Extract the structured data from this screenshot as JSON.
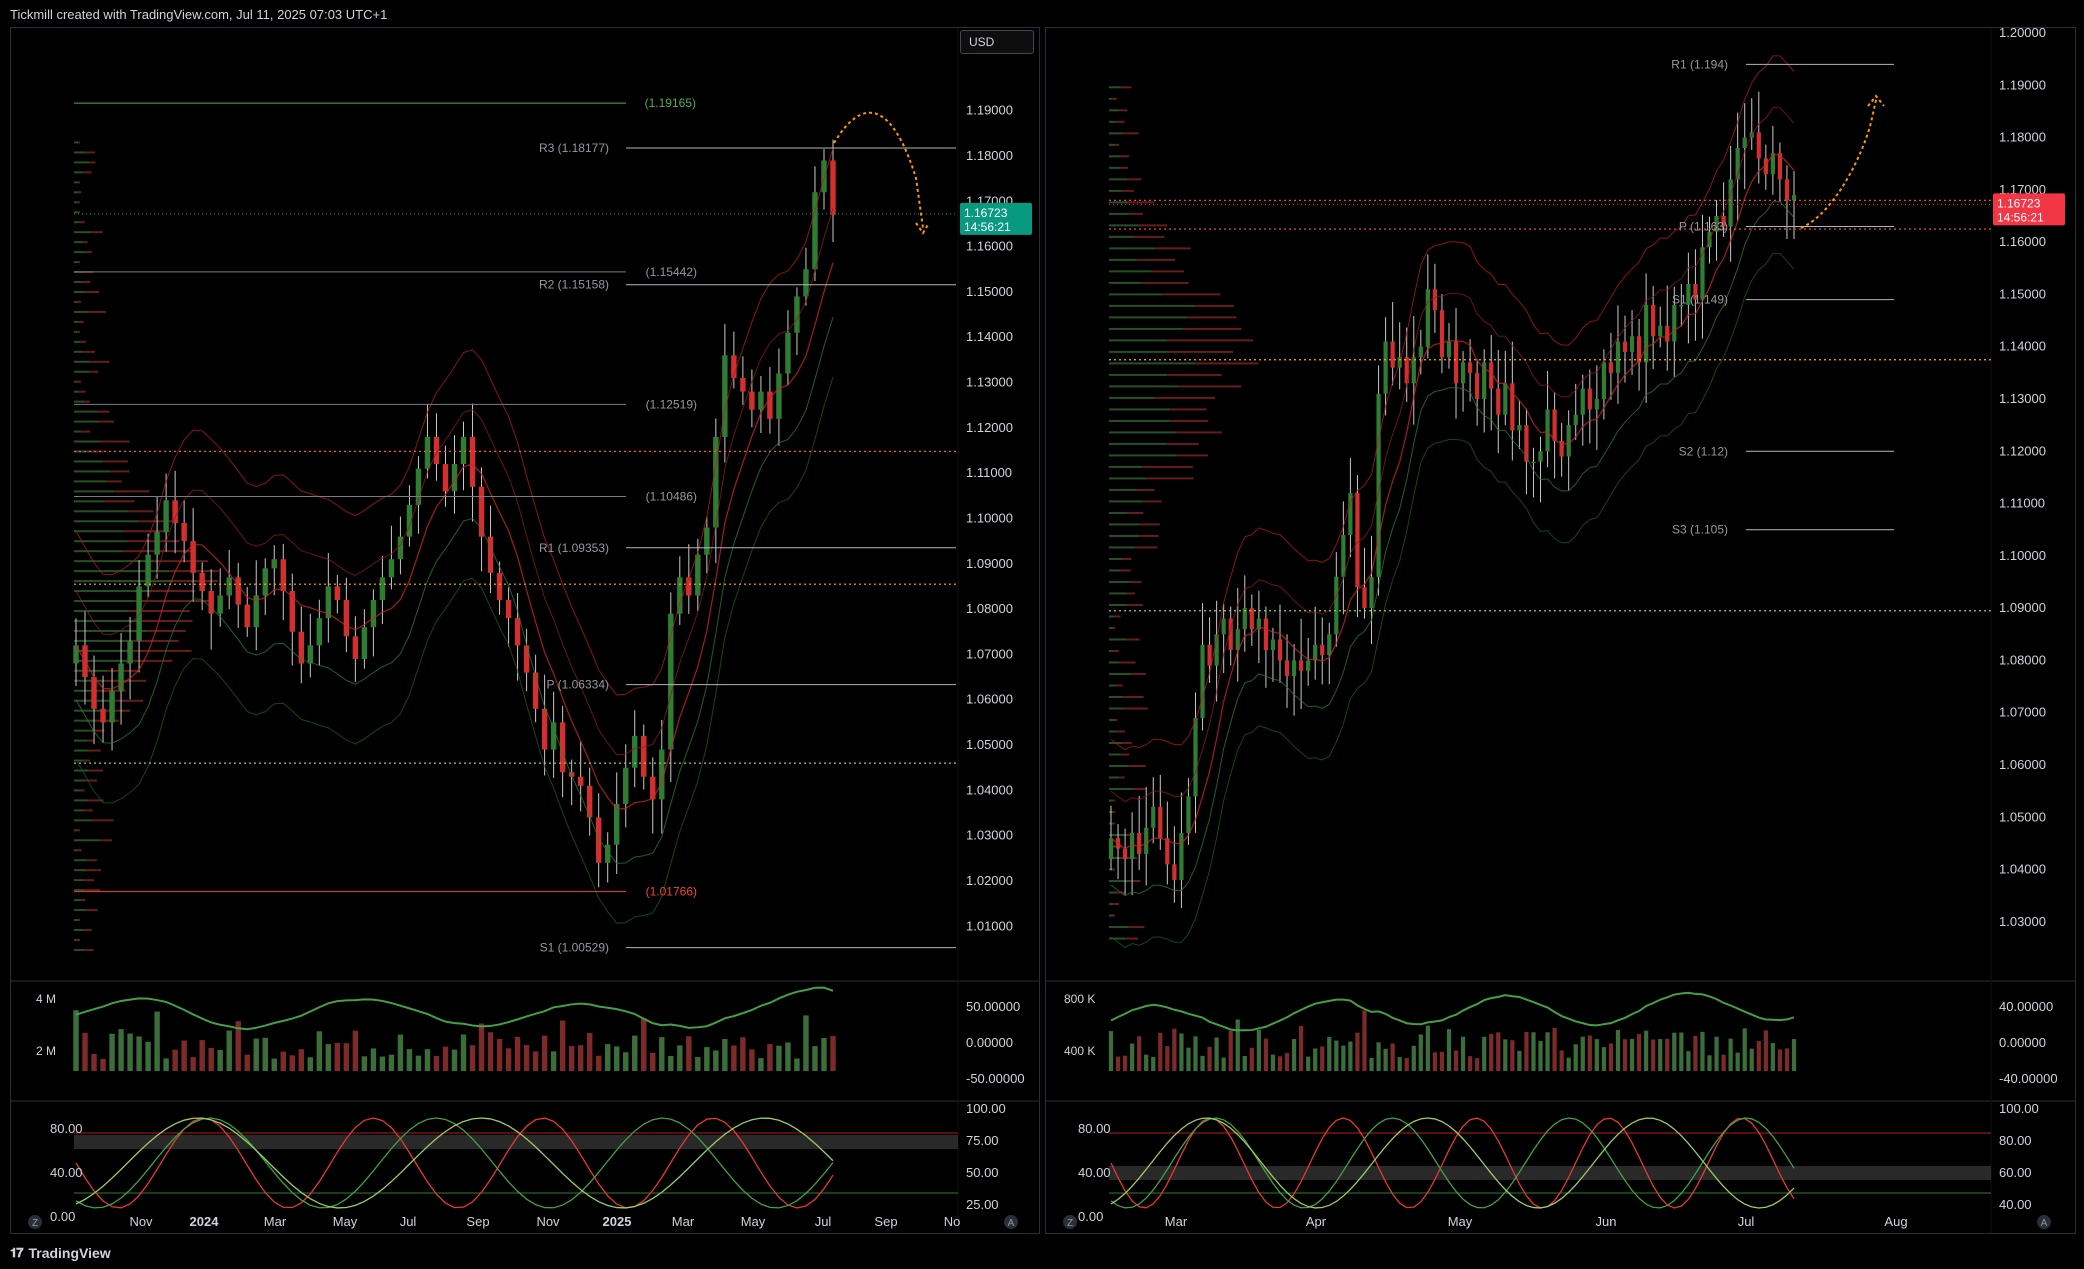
{
  "header": {
    "attribution": "Tickmill created with TradingView.com, Jul 11, 2025 07:03 UTC+1"
  },
  "footer": {
    "brand": "TradingView"
  },
  "currency_selector": {
    "label": "USD"
  },
  "colors": {
    "up": "#2e7d32",
    "down": "#d32f2f",
    "last_left": "#089981",
    "last_right": "#f23645",
    "pivot_line": "#ffffff",
    "orange": "#ff9800"
  },
  "left_chart": {
    "price_axis": [
      "1.19000",
      "1.18000",
      "1.17000",
      "1.16000",
      "1.15000",
      "1.14000",
      "1.13000",
      "1.12000",
      "1.11000",
      "1.10000",
      "1.09000",
      "1.08000",
      "1.07000",
      "1.06000",
      "1.05000",
      "1.04000",
      "1.03000",
      "1.02000",
      "1.01000"
    ],
    "last_price": "1.16723",
    "countdown": "14:56:21",
    "levels": [
      {
        "label": "(1.19165)",
        "color": "green"
      },
      {
        "label": "R3 (1.18177)",
        "color": "white"
      },
      {
        "label": "(1.15442)",
        "color": "gray"
      },
      {
        "label": "R2 (1.15158)",
        "color": "white"
      },
      {
        "label": "(1.12519)",
        "color": "gray"
      },
      {
        "label": "(1.10486)",
        "color": "gray"
      },
      {
        "label": "R1 (1.09353)",
        "color": "white"
      },
      {
        "label": "P (1.06334)",
        "color": "white"
      },
      {
        "label": "(1.01766)",
        "color": "red"
      },
      {
        "label": "S1 (1.00529)",
        "color": "white"
      }
    ],
    "volume_axis": [
      "4 M",
      "2 M"
    ],
    "osc_axis": [
      "50.00000",
      "0.00000",
      "-50.00000"
    ],
    "stoch_axis_left": [
      "80.00",
      "40.00",
      "0.00"
    ],
    "stoch_axis_right": [
      "100.00",
      "75.00",
      "50.00",
      "25.00"
    ],
    "time_axis": [
      "Nov",
      "2024",
      "Mar",
      "May",
      "Jul",
      "Sep",
      "Nov",
      "2025",
      "Mar",
      "May",
      "Jul",
      "Sep",
      "No"
    ],
    "corner_left": "Z",
    "corner_right": "A"
  },
  "right_chart": {
    "price_axis": [
      "1.20000",
      "1.19000",
      "1.18000",
      "1.17000",
      "1.16000",
      "1.15000",
      "1.14000",
      "1.13000",
      "1.12000",
      "1.11000",
      "1.10000",
      "1.09000",
      "1.08000",
      "1.07000",
      "1.06000",
      "1.05000",
      "1.04000",
      "1.03000"
    ],
    "last_price": "1.16723",
    "countdown": "14:56:21",
    "levels": [
      {
        "label": "R1 (1.194)"
      },
      {
        "label": "P (1.163)"
      },
      {
        "label": "S1 (1.149)"
      },
      {
        "label": "S2 (1.12)"
      },
      {
        "label": "S3 (1.105)"
      }
    ],
    "volume_axis": [
      "800 K",
      "400 K"
    ],
    "osc_axis": [
      "40.00000",
      "0.00000",
      "-40.00000"
    ],
    "stoch_axis_left": [
      "80.00",
      "40.00",
      "0.00"
    ],
    "stoch_axis_right": [
      "100.00",
      "80.00",
      "60.00",
      "40.00"
    ],
    "time_axis": [
      "Mar",
      "Apr",
      "May",
      "Jun",
      "Jul",
      "Aug"
    ],
    "corner_left": "Z",
    "corner_right": "A"
  },
  "chart_data": [
    {
      "type": "candlestick",
      "title": "",
      "timeframe": "weekly",
      "ylim": [
        1.003,
        1.195
      ],
      "x_range": [
        "2023-09",
        "2025-11"
      ],
      "closes_approx": [
        1.072,
        1.065,
        1.058,
        1.055,
        1.062,
        1.068,
        1.073,
        1.085,
        1.092,
        1.097,
        1.104,
        1.099,
        1.095,
        1.088,
        1.084,
        1.079,
        1.083,
        1.087,
        1.081,
        1.076,
        1.083,
        1.089,
        1.091,
        1.084,
        1.075,
        1.068,
        1.072,
        1.078,
        1.085,
        1.082,
        1.074,
        1.069,
        1.076,
        1.082,
        1.087,
        1.091,
        1.096,
        1.103,
        1.111,
        1.118,
        1.112,
        1.106,
        1.112,
        1.118,
        1.107,
        1.096,
        1.088,
        1.082,
        1.078,
        1.072,
        1.066,
        1.058,
        1.049,
        1.055,
        1.044,
        1.043,
        1.041,
        1.034,
        1.024,
        1.028,
        1.037,
        1.045,
        1.052,
        1.043,
        1.038,
        1.049,
        1.079,
        1.087,
        1.083,
        1.092,
        1.098,
        1.118,
        1.136,
        1.131,
        1.128,
        1.124,
        1.128,
        1.122,
        1.132,
        1.141,
        1.149,
        1.155,
        1.172,
        1.179,
        1.167
      ],
      "pivots": {
        "R3": 1.18177,
        "R2": 1.15158,
        "R1": 1.09353,
        "P": 1.06334,
        "S1": 1.00529
      },
      "annotations": [
        1.19165,
        1.15442,
        1.12519,
        1.10486,
        1.01766
      ],
      "last_price": 1.16723
    },
    {
      "type": "candlestick",
      "title": "",
      "timeframe": "daily",
      "ylim": [
        1.025,
        1.2
      ],
      "x_range": [
        "2025-02-20",
        "2025-08-15"
      ],
      "closes_approx": [
        1.046,
        1.044,
        1.042,
        1.047,
        1.043,
        1.048,
        1.052,
        1.046,
        1.041,
        1.038,
        1.047,
        1.054,
        1.069,
        1.083,
        1.079,
        1.085,
        1.088,
        1.082,
        1.086,
        1.09,
        1.086,
        1.088,
        1.082,
        1.084,
        1.08,
        1.077,
        1.08,
        1.078,
        1.08,
        1.083,
        1.081,
        1.085,
        1.096,
        1.104,
        1.112,
        1.094,
        1.09,
        1.096,
        1.131,
        1.141,
        1.136,
        1.138,
        1.133,
        1.138,
        1.14,
        1.151,
        1.147,
        1.138,
        1.141,
        1.133,
        1.137,
        1.135,
        1.13,
        1.137,
        1.132,
        1.127,
        1.133,
        1.124,
        1.125,
        1.118,
        1.118,
        1.12,
        1.128,
        1.122,
        1.119,
        1.125,
        1.127,
        1.132,
        1.128,
        1.13,
        1.137,
        1.135,
        1.141,
        1.139,
        1.142,
        1.137,
        1.148,
        1.142,
        1.144,
        1.141,
        1.148,
        1.148,
        1.152,
        1.149,
        1.159,
        1.162,
        1.165,
        1.163,
        1.172,
        1.178,
        1.18,
        1.181,
        1.176,
        1.173,
        1.177,
        1.172,
        1.168,
        1.169
      ],
      "pivots": {
        "R1": 1.194,
        "P": 1.163,
        "S1": 1.149,
        "S2": 1.12,
        "S3": 1.105
      },
      "last_price": 1.16723
    }
  ]
}
